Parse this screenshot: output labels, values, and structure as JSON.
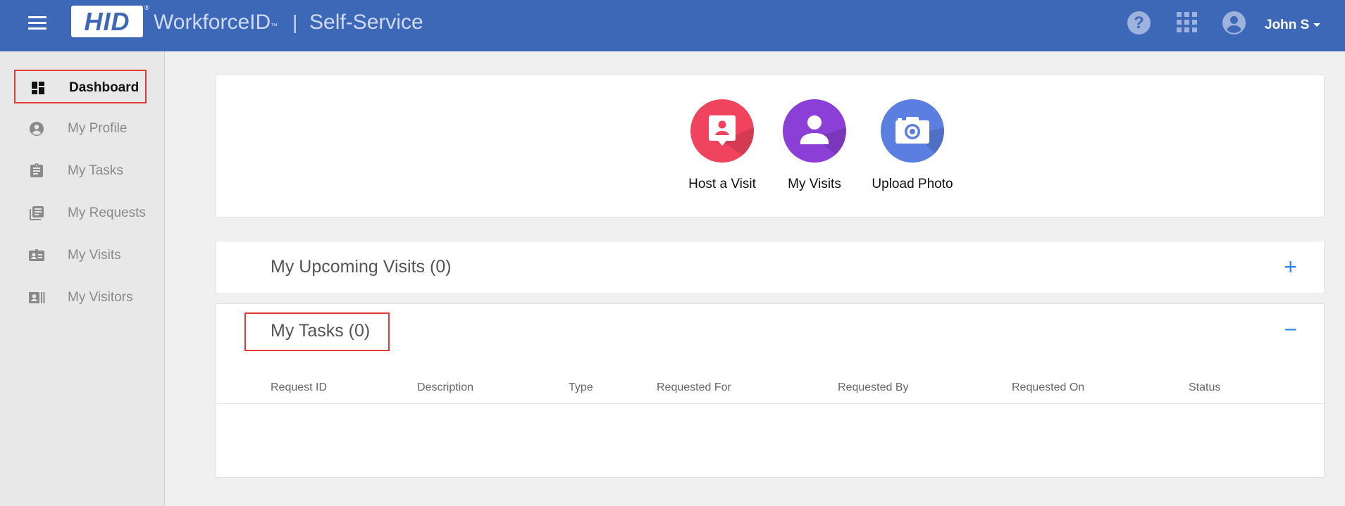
{
  "header": {
    "logo_text": "HID",
    "logo_mark": "®",
    "product_name": "WorkforceID",
    "trademark": "™",
    "separator": "|",
    "module_name": "Self-Service",
    "user_name": "John S",
    "icons": [
      "menu-icon",
      "help-icon",
      "apps-grid-icon",
      "account-circle-icon"
    ]
  },
  "sidebar": {
    "items": [
      {
        "label": "Dashboard",
        "icon": "dashboard-icon",
        "active": true
      },
      {
        "label": "My Profile",
        "icon": "account-circle-icon",
        "active": false
      },
      {
        "label": "My Tasks",
        "icon": "clipboard-icon",
        "active": false
      },
      {
        "label": "My Requests",
        "icon": "library-books-icon",
        "active": false
      },
      {
        "label": "My Visits",
        "icon": "badge-icon",
        "active": false
      },
      {
        "label": "My Visitors",
        "icon": "contact-list-icon",
        "active": false
      }
    ]
  },
  "quick_actions": [
    {
      "label": "Host a Visit",
      "icon": "person-pin-icon",
      "color": "#f0445e"
    },
    {
      "label": "My Visits",
      "icon": "person-icon",
      "color": "#8b3fd6"
    },
    {
      "label": "Upload Photo",
      "icon": "camera-icon",
      "color": "#5b7fe0"
    }
  ],
  "upcoming_visits": {
    "title": "My Upcoming Visits (0)",
    "toggle": "+"
  },
  "my_tasks": {
    "title": "My Tasks (0)",
    "toggle": "−",
    "columns": [
      "Request ID",
      "Description",
      "Type",
      "Requested For",
      "Requested By",
      "Requested On",
      "Status"
    ],
    "rows": []
  },
  "colors": {
    "header_bg": "#3d68b8",
    "accent_blue": "#2e8de8",
    "highlight_red": "#e53935"
  }
}
